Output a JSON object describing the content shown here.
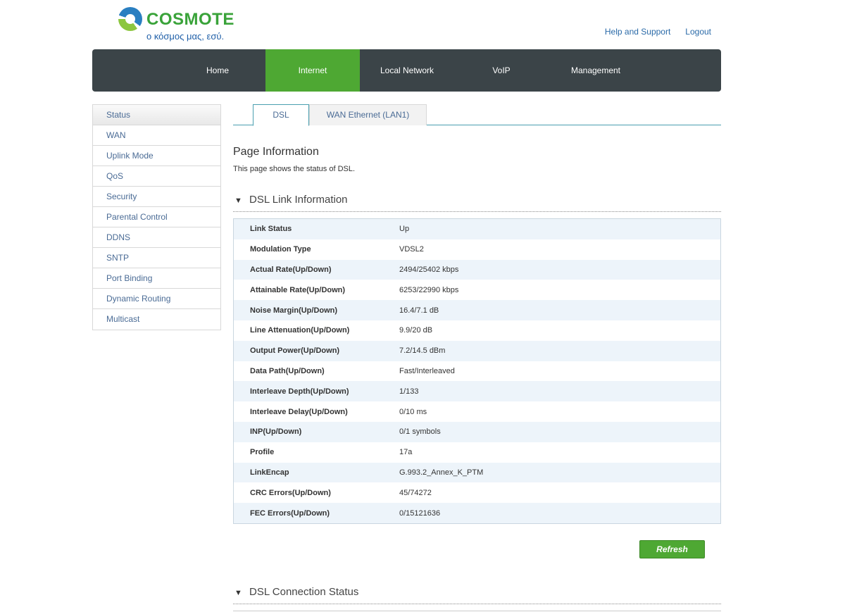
{
  "brand": {
    "name": "COSMOTE",
    "tagline": "ο κόσμος μας, εσύ."
  },
  "toplinks": {
    "help": "Help and Support",
    "logout": "Logout"
  },
  "nav": [
    "Home",
    "Internet",
    "Local Network",
    "VoIP",
    "Management"
  ],
  "sidebar": [
    "Status",
    "WAN",
    "Uplink Mode",
    "QoS",
    "Security",
    "Parental Control",
    "DDNS",
    "SNTP",
    "Port Binding",
    "Dynamic Routing",
    "Multicast"
  ],
  "tabs": [
    "DSL",
    "WAN Ethernet (LAN1)"
  ],
  "page": {
    "title": "Page Information",
    "desc": "This page shows the status of DSL."
  },
  "section1": "DSL Link Information",
  "rows": [
    {
      "k": "Link Status",
      "v": "Up"
    },
    {
      "k": "Modulation Type",
      "v": "VDSL2"
    },
    {
      "k": "Actual Rate(Up/Down)",
      "v": "2494/25402 kbps"
    },
    {
      "k": "Attainable Rate(Up/Down)",
      "v": "6253/22990 kbps"
    },
    {
      "k": "Noise Margin(Up/Down)",
      "v": "16.4/7.1 dB"
    },
    {
      "k": "Line Attenuation(Up/Down)",
      "v": "9.9/20 dB"
    },
    {
      "k": "Output Power(Up/Down)",
      "v": "7.2/14.5 dBm"
    },
    {
      "k": "Data Path(Up/Down)",
      "v": "Fast/Interleaved"
    },
    {
      "k": "Interleave Depth(Up/Down)",
      "v": "1/133"
    },
    {
      "k": "Interleave Delay(Up/Down)",
      "v": "0/10 ms"
    },
    {
      "k": "INP(Up/Down)",
      "v": "0/1 symbols"
    },
    {
      "k": "Profile",
      "v": "17a"
    },
    {
      "k": "LinkEncap",
      "v": "G.993.2_Annex_K_PTM"
    },
    {
      "k": "CRC Errors(Up/Down)",
      "v": "45/74272"
    },
    {
      "k": "FEC Errors(Up/Down)",
      "v": "0/15121636"
    }
  ],
  "refresh": "Refresh",
  "section2": "DSL Connection Status",
  "colors": {
    "accent": "#4ea833",
    "nav": "#3b4448"
  }
}
